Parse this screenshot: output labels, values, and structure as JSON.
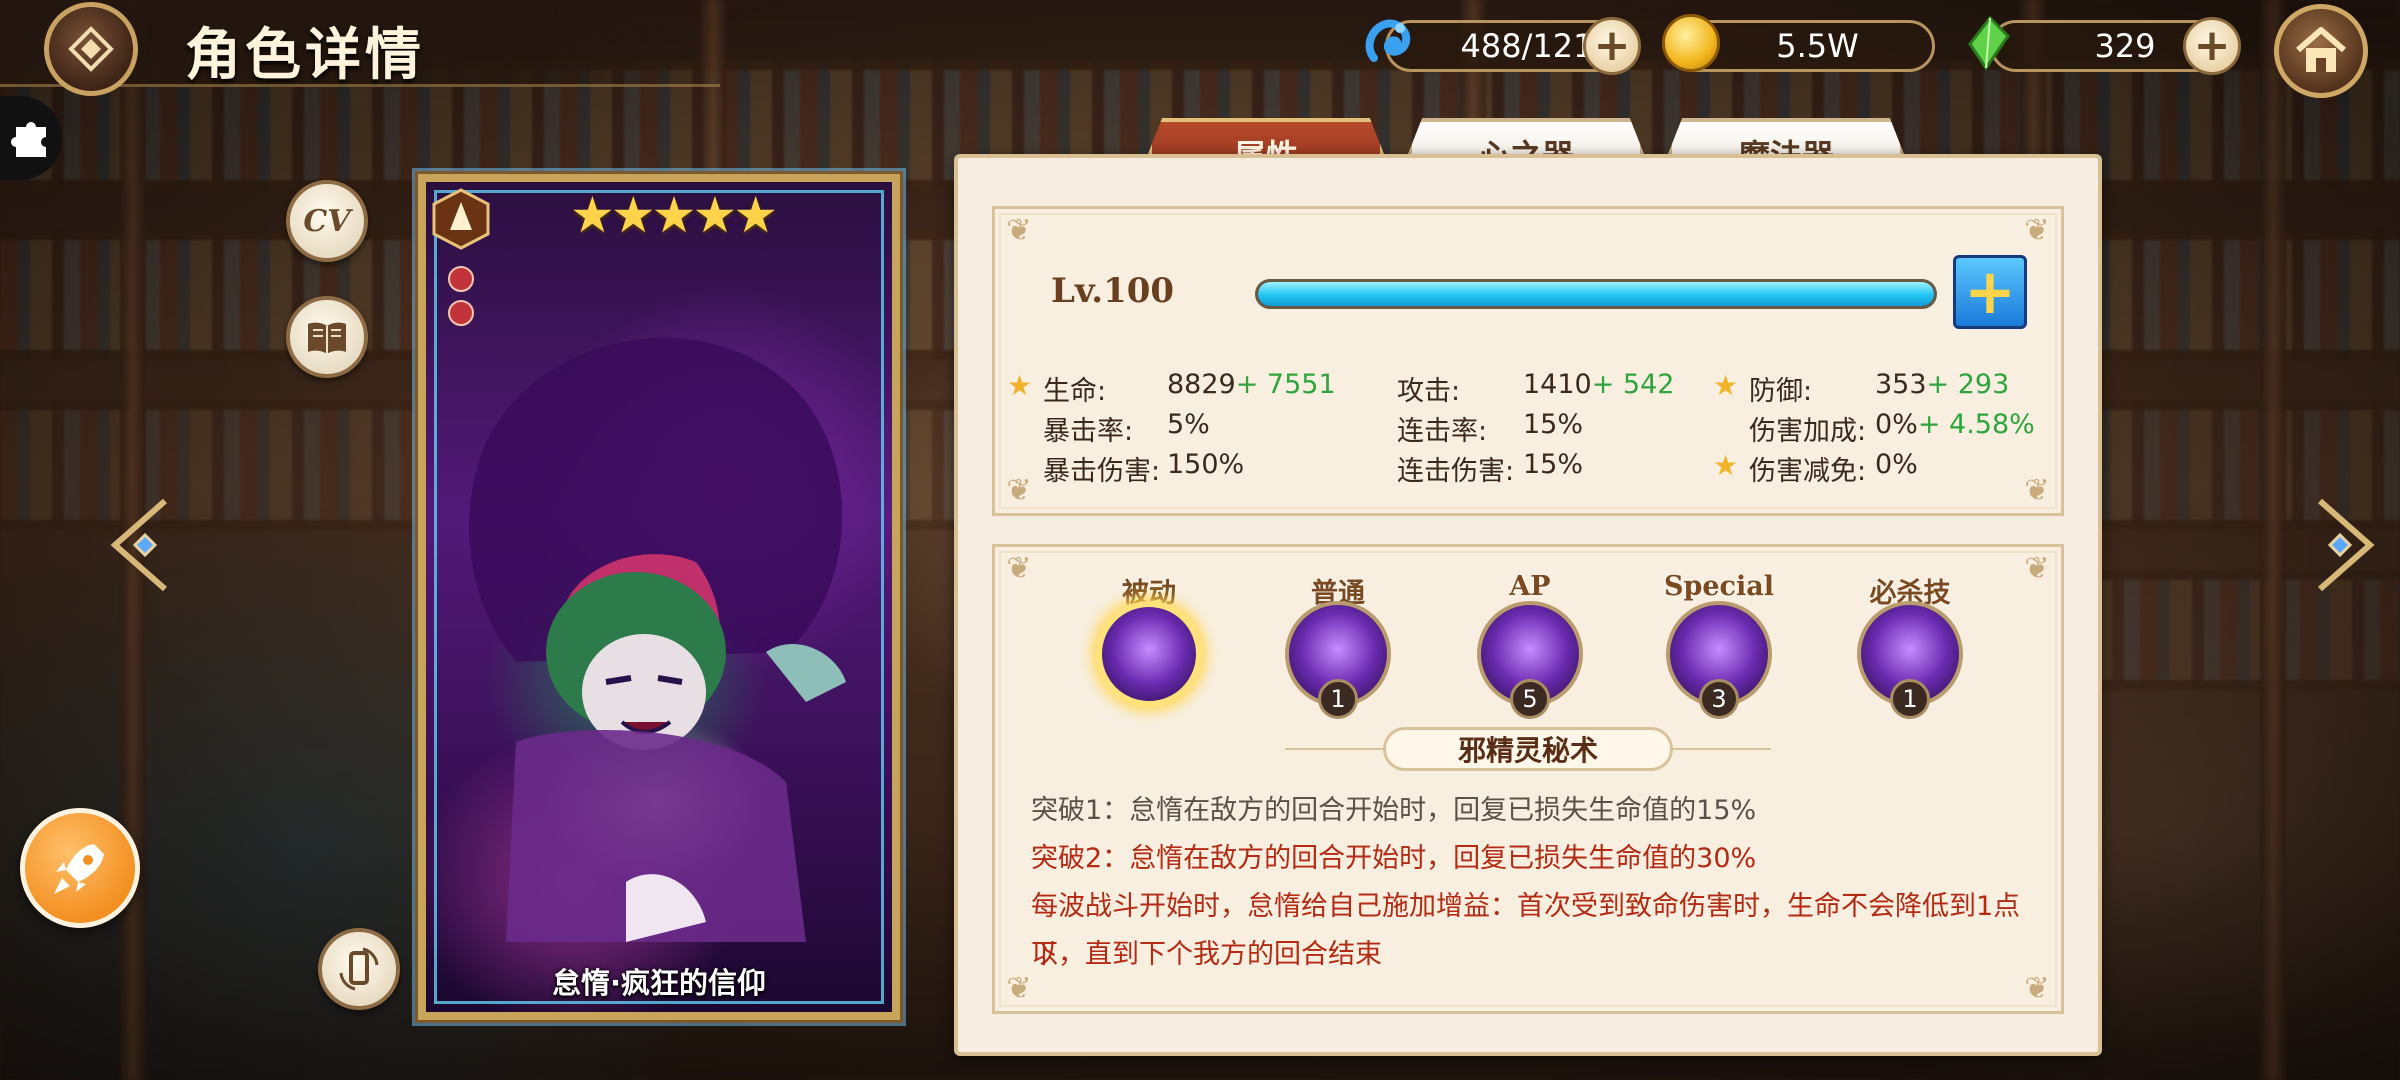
{
  "header": {
    "title": "角色详情"
  },
  "resources": [
    {
      "name": "spirit",
      "value": "488/121",
      "icon": "blue-spirit-icon"
    },
    {
      "name": "gold",
      "value": "5.5W",
      "icon": "gold-coin-icon"
    },
    {
      "name": "gem",
      "value": "329",
      "icon": "green-crystal-icon"
    }
  ],
  "side_buttons": {
    "cv_label": "CV"
  },
  "card": {
    "name": "怠惰·疯狂的信仰",
    "stars": "★★★★★"
  },
  "tabs": [
    {
      "label": "属性",
      "active": true
    },
    {
      "label": "心之器",
      "active": false
    },
    {
      "label": "魔法器",
      "active": false
    }
  ],
  "level": {
    "label": "Lv.100",
    "progress": 1.0
  },
  "stats": {
    "hp_label": "生命:",
    "hp": "8829",
    "hp_bonus": "+ 7551",
    "atk_label": "攻击:",
    "atk": "1410",
    "atk_bonus": "+ 542",
    "def_label": "防御:",
    "def": "353",
    "def_bonus": "+ 293",
    "crit_rate_label": "暴击率:",
    "crit_rate": "5%",
    "combo_rate_label": "连击率:",
    "combo_rate": "15%",
    "dmg_bonus_label": "伤害加成:",
    "dmg_bonus": "0%",
    "dmg_bonus_bonus": "+ 4.58%",
    "crit_dmg_label": "暴击伤害:",
    "crit_dmg": "150%",
    "combo_dmg_label": "连击伤害:",
    "combo_dmg": "15%",
    "dmg_reduce_label": "伤害减免:",
    "dmg_reduce": "0%"
  },
  "skills": [
    {
      "name": "被动",
      "level": "",
      "selected": true
    },
    {
      "name": "普通",
      "level": "1",
      "selected": false
    },
    {
      "name": "AP",
      "level": "5",
      "selected": false
    },
    {
      "name": "Special",
      "level": "3",
      "selected": false
    },
    {
      "name": "必杀技",
      "level": "1",
      "selected": false
    }
  ],
  "skill_detail": {
    "title": "邪精灵秘术",
    "line1": "突破1：怠惰在敌方的回合开始时，回复已损失生命值的15%",
    "line2": "突破2：怠惰在敌方的回合开始时，回复已损失生命值的30%",
    "line3a": "每波战斗开始时，怠惰给自己施加增益：首次受到致命伤害时，生命不会降低到1点以",
    "line3b": "下，直到下个我方的回合结束"
  }
}
